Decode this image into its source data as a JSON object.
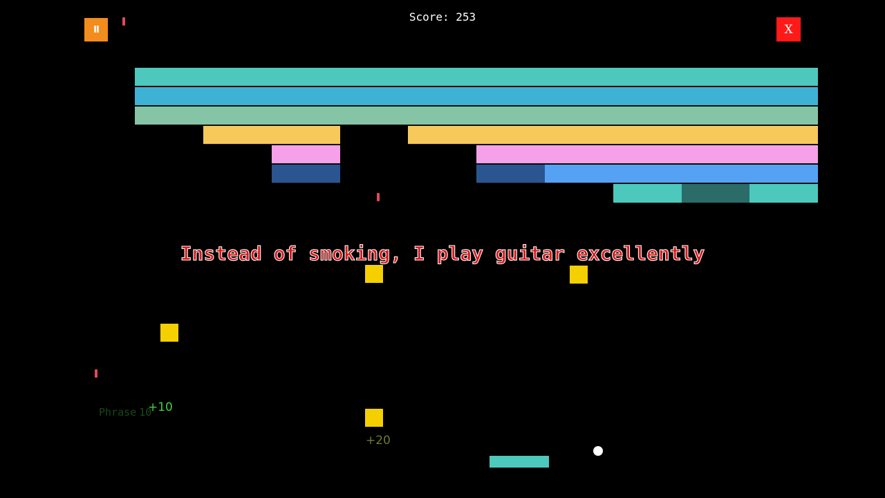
{
  "hud": {
    "pause_icon": "pause-icon",
    "pause_glyph": "II",
    "close_icon": "close-icon",
    "close_glyph": "X",
    "score_label": "Score:",
    "score_value": "253",
    "pause_color": "#f28c1e",
    "close_color": "#ff1a1a"
  },
  "phrase": "Instead of smoking, I play guitar excellently",
  "phase": {
    "label": "Phrase",
    "value": "10"
  },
  "popups": {
    "bonus_a": "+10",
    "bonus_b": "+20"
  },
  "colors": {
    "teal": "#4cc8bd",
    "blue": "#3eb2d4",
    "sage": "#86c4a6",
    "gold": "#f7c85a",
    "pink": "#f5a0e8",
    "navy": "#2a5590",
    "sky": "#55a2f5",
    "dark_teal": "#2b6b68",
    "powerup": "#f5d000",
    "drop": "#e04a5a",
    "paddle": "#4cc8bd",
    "ball": "#ffffff"
  }
}
